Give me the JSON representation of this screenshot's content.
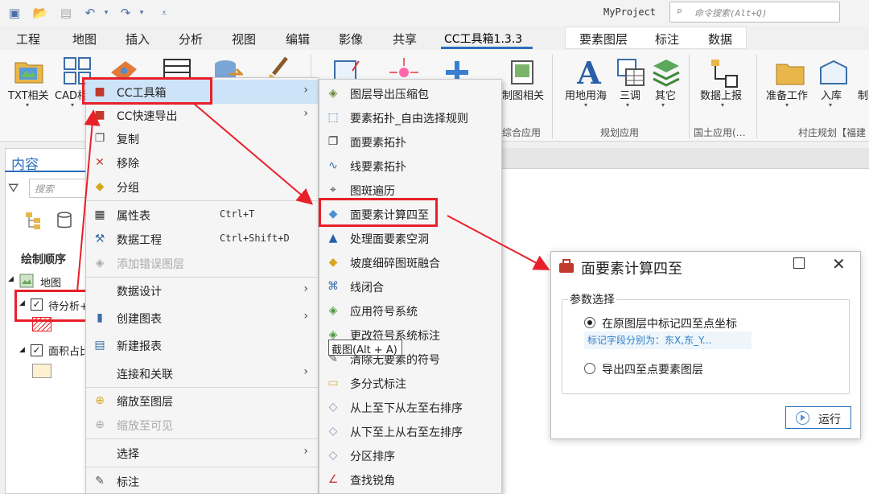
{
  "app": {
    "project_name": "MyProject",
    "command_search_placeholder": "命令搜索(Alt+Q)"
  },
  "ribbon_tabs": [
    "工程",
    "地图",
    "插入",
    "分析",
    "视图",
    "编辑",
    "影像",
    "共享",
    "CC工具箱1.3.3",
    "要素图层",
    "标注",
    "数据"
  ],
  "ribbon": {
    "buttons": [
      {
        "label": "TXT相关",
        "has_dropdown": true
      },
      {
        "label": "CAD相",
        "has_dropdown": true
      },
      {
        "label": "制图相关",
        "has_dropdown": false
      },
      {
        "label": "用地用海",
        "has_dropdown": true
      },
      {
        "label": "三调",
        "has_dropdown": true
      },
      {
        "label": "其它",
        "has_dropdown": true
      },
      {
        "label": "数据上报",
        "has_dropdown": true
      },
      {
        "label": "准备工作",
        "has_dropdown": true
      },
      {
        "label": "入库",
        "has_dropdown": true
      },
      {
        "label": "制",
        "has_dropdown": false
      }
    ],
    "groups": [
      "综合应用",
      "规划应用",
      "国土应用(…",
      "村庄规划【福建"
    ]
  },
  "contents": {
    "title": "内容",
    "search_placeholder": "搜索",
    "draw_order": "绘制顺序",
    "tree": [
      {
        "label": "地图"
      },
      {
        "label": "待分析+",
        "checked": true
      },
      {
        "label": "面积占比",
        "checked": true
      }
    ]
  },
  "context_menu": {
    "items": [
      {
        "label": "CC工具箱",
        "submenu": true,
        "icon": "toolbox-icon"
      },
      {
        "label": "CC快速导出",
        "submenu": true,
        "icon": "toolbox-icon"
      },
      {
        "label": "复制",
        "icon": "copy-icon"
      },
      {
        "label": "移除",
        "icon": "remove-icon"
      },
      {
        "label": "分组",
        "icon": "group-icon"
      },
      {
        "label": "属性表",
        "shortcut": "Ctrl+T",
        "icon": "table-icon"
      },
      {
        "label": "数据工程",
        "shortcut": "Ctrl+Shift+D",
        "icon": "data-engineering-icon"
      },
      {
        "label": "添加错误图层",
        "disabled": true,
        "icon": "error-layer-icon"
      },
      {
        "label": "数据设计",
        "submenu": true
      },
      {
        "label": "创建图表",
        "submenu": true,
        "icon": "chart-icon"
      },
      {
        "label": "新建报表",
        "icon": "report-icon"
      },
      {
        "label": "连接和关联",
        "submenu": true
      },
      {
        "label": "缩放至图层",
        "icon": "zoom-layer-icon"
      },
      {
        "label": "缩放至可见",
        "disabled": true,
        "icon": "zoom-visible-icon"
      },
      {
        "label": "选择",
        "submenu": true
      },
      {
        "label": "标注",
        "icon": "label-icon"
      }
    ]
  },
  "submenu": {
    "items": [
      {
        "label": "图层导出压缩包"
      },
      {
        "label": "要素拓扑_自由选择规则"
      },
      {
        "label": "面要素拓扑"
      },
      {
        "label": "线要素拓扑"
      },
      {
        "label": "图斑遍历"
      },
      {
        "label": "面要素计算四至"
      },
      {
        "label": "处理面要素空洞"
      },
      {
        "label": "坡度细碎图斑融合"
      },
      {
        "label": "线闭合"
      },
      {
        "label": "应用符号系统"
      },
      {
        "label": "更改符号系统标注"
      },
      {
        "label": "清除无要素的符号"
      },
      {
        "label": "多分式标注"
      },
      {
        "label": "从上至下从左至右排序"
      },
      {
        "label": "从下至上从右至左排序"
      },
      {
        "label": "分区排序"
      },
      {
        "label": "查找锐角"
      }
    ]
  },
  "tooltip": "截图(Alt + A)",
  "dialog": {
    "title": "面要素计算四至",
    "section": "参数选择",
    "option1": "在原图层中标记四至点坐标",
    "hint": "标记字段分别为：东X,东_Y...",
    "option2": "导出四至点要素图层",
    "run": "运行",
    "selected_option": 1
  },
  "colors": {
    "accent": "#2a6ebb",
    "annotation_red": "#e8202a"
  }
}
